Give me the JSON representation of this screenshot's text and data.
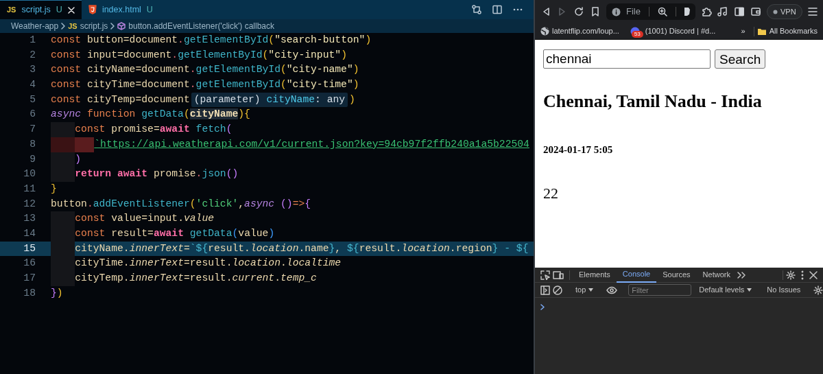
{
  "editor": {
    "tabs": [
      {
        "kind": "js",
        "badge": "JS",
        "label": "script.js",
        "status": "U",
        "selected": true,
        "closable": true
      },
      {
        "kind": "html",
        "label": "index.html",
        "status": "U",
        "selected": false,
        "closable": false
      }
    ],
    "breadcrumb": [
      {
        "kind": "folder",
        "text": "Weather-app"
      },
      {
        "kind": "js",
        "badge": "JS",
        "text": "script.js"
      },
      {
        "kind": "symbol",
        "text": "button.addEventListener('click') callback"
      }
    ],
    "lines": [
      {
        "number": "1",
        "selected": false,
        "tokens": [
          {
            "kind": "kw",
            "text": "const "
          },
          {
            "kind": "var",
            "text": "button=document"
          },
          {
            "kind": "dot",
            "text": "."
          },
          {
            "kind": "fn",
            "text": "getElementById"
          },
          {
            "kind": "br1",
            "text": "("
          },
          {
            "kind": "str",
            "text": "\"search-button\""
          },
          {
            "kind": "br1",
            "text": ")"
          }
        ]
      },
      {
        "number": "2",
        "selected": false,
        "tokens": [
          {
            "kind": "kw",
            "text": "const "
          },
          {
            "kind": "var",
            "text": "input=document"
          },
          {
            "kind": "dot",
            "text": "."
          },
          {
            "kind": "fn",
            "text": "getElementById"
          },
          {
            "kind": "br1",
            "text": "("
          },
          {
            "kind": "str",
            "text": "\"city-input\""
          },
          {
            "kind": "br1",
            "text": ")"
          }
        ]
      },
      {
        "number": "3",
        "selected": false,
        "tokens": [
          {
            "kind": "kw",
            "text": "const "
          },
          {
            "kind": "var",
            "text": "cityName=document"
          },
          {
            "kind": "dot",
            "text": "."
          },
          {
            "kind": "fn",
            "text": "getElementById"
          },
          {
            "kind": "br1",
            "text": "("
          },
          {
            "kind": "str",
            "text": "\"city-name\""
          },
          {
            "kind": "br1",
            "text": ")"
          }
        ]
      },
      {
        "number": "4",
        "selected": false,
        "tokens": [
          {
            "kind": "kw",
            "text": "const "
          },
          {
            "kind": "var",
            "text": "cityTime=document"
          },
          {
            "kind": "dot",
            "text": "."
          },
          {
            "kind": "fn",
            "text": "getElementById"
          },
          {
            "kind": "br1",
            "text": "("
          },
          {
            "kind": "str",
            "text": "\"city-time\""
          },
          {
            "kind": "br1",
            "text": ")"
          }
        ]
      },
      {
        "number": "5",
        "selected": false,
        "tokens": [
          {
            "kind": "kw",
            "text": "const "
          },
          {
            "kind": "var",
            "text": "cityTemp=document"
          },
          {
            "kind": "tooltip",
            "parts": [
              {
                "kind": "tip",
                "text": "(parameter) "
              },
              {
                "kind": "tipname",
                "text": "cityName"
              },
              {
                "kind": "tip",
                "text": ": any"
              }
            ]
          },
          {
            "kind": "br1",
            "text": ")"
          }
        ]
      },
      {
        "number": "6",
        "selected": false,
        "tokens": [
          {
            "kind": "async",
            "text": "async "
          },
          {
            "kind": "kw",
            "text": "function "
          },
          {
            "kind": "fn",
            "text": "getData"
          },
          {
            "kind": "br1",
            "text": "("
          },
          {
            "kind": "param",
            "text": "cityName"
          },
          {
            "kind": "br1",
            "text": "){"
          }
        ]
      },
      {
        "number": "7",
        "selected": false,
        "indent": [
          {
            "kind": "plain"
          }
        ],
        "tokens": [
          {
            "kind": "kw",
            "text": "const "
          },
          {
            "kind": "var",
            "text": "promise="
          },
          {
            "kind": "await",
            "text": "await "
          },
          {
            "kind": "fn",
            "text": "fetch"
          },
          {
            "kind": "br2",
            "text": "("
          }
        ]
      },
      {
        "number": "8",
        "selected": false,
        "indent": [
          {
            "kind": "error"
          },
          {
            "kind": "error"
          }
        ],
        "tokens": [
          {
            "kind": "url",
            "text": "`https://api.weatherapi.com/v1/current.json?key=94cb97f2ffb240a1a5b22504"
          }
        ]
      },
      {
        "number": "9",
        "selected": false,
        "indent": [
          {
            "kind": "plain"
          }
        ],
        "tokens": [
          {
            "kind": "br2",
            "text": ")"
          }
        ]
      },
      {
        "number": "10",
        "selected": false,
        "indent": [
          {
            "kind": "plain"
          }
        ],
        "tokens": [
          {
            "kind": "await",
            "text": "return await "
          },
          {
            "kind": "var",
            "text": "promise"
          },
          {
            "kind": "dot",
            "text": "."
          },
          {
            "kind": "fn",
            "text": "json"
          },
          {
            "kind": "br2",
            "text": "()"
          }
        ]
      },
      {
        "number": "11",
        "selected": false,
        "tokens": [
          {
            "kind": "br1",
            "text": "}"
          }
        ]
      },
      {
        "number": "12",
        "selected": false,
        "tokens": [
          {
            "kind": "var",
            "text": "button"
          },
          {
            "kind": "dot",
            "text": "."
          },
          {
            "kind": "fn",
            "text": "addEventListener"
          },
          {
            "kind": "br1",
            "text": "("
          },
          {
            "kind": "str2",
            "text": "'click'"
          },
          {
            "kind": "var",
            "text": ","
          },
          {
            "kind": "async",
            "text": "async "
          },
          {
            "kind": "br2",
            "text": "()"
          },
          {
            "kind": "kw",
            "text": "=>"
          },
          {
            "kind": "br2",
            "text": "{"
          }
        ]
      },
      {
        "number": "13",
        "selected": false,
        "indent": [
          {
            "kind": "plain"
          }
        ],
        "tokens": [
          {
            "kind": "kw",
            "text": "const "
          },
          {
            "kind": "var",
            "text": "value=input."
          },
          {
            "kind": "it",
            "text": "value"
          }
        ]
      },
      {
        "number": "14",
        "selected": false,
        "indent": [
          {
            "kind": "plain"
          }
        ],
        "tokens": [
          {
            "kind": "kw",
            "text": "const "
          },
          {
            "kind": "var",
            "text": "result="
          },
          {
            "kind": "await",
            "text": "await "
          },
          {
            "kind": "fn",
            "text": "getData"
          },
          {
            "kind": "br3",
            "text": "("
          },
          {
            "kind": "var",
            "text": "value"
          },
          {
            "kind": "br3",
            "text": ")"
          }
        ]
      },
      {
        "number": "15",
        "selected": true,
        "indent": [
          {
            "kind": "plain"
          }
        ],
        "tokens": [
          {
            "kind": "var",
            "text": "cityName."
          },
          {
            "kind": "it",
            "text": "innerText"
          },
          {
            "kind": "var",
            "text": "="
          },
          {
            "kind": "tpl",
            "text": "`${"
          },
          {
            "kind": "var",
            "text": "result."
          },
          {
            "kind": "it",
            "text": "location"
          },
          {
            "kind": "var",
            "text": ".name"
          },
          {
            "kind": "tpl",
            "text": "}"
          },
          {
            "kind": "var",
            "text": ", "
          },
          {
            "kind": "tpl",
            "text": "${"
          },
          {
            "kind": "var",
            "text": "result."
          },
          {
            "kind": "it",
            "text": "location"
          },
          {
            "kind": "var",
            "text": ".region"
          },
          {
            "kind": "tpl",
            "text": "} - ${"
          }
        ]
      },
      {
        "number": "16",
        "selected": false,
        "indent": [
          {
            "kind": "plain"
          }
        ],
        "tokens": [
          {
            "kind": "var",
            "text": "cityTime."
          },
          {
            "kind": "it",
            "text": "innerText"
          },
          {
            "kind": "var",
            "text": "=result."
          },
          {
            "kind": "it",
            "text": "location"
          },
          {
            "kind": "var",
            "text": "."
          },
          {
            "kind": "it",
            "text": "localtime"
          }
        ]
      },
      {
        "number": "17",
        "selected": false,
        "indent": [
          {
            "kind": "plain"
          }
        ],
        "tokens": [
          {
            "kind": "var",
            "text": "cityTemp."
          },
          {
            "kind": "it",
            "text": "innerText"
          },
          {
            "kind": "var",
            "text": "=result."
          },
          {
            "kind": "it",
            "text": "current"
          },
          {
            "kind": "var",
            "text": "."
          },
          {
            "kind": "it",
            "text": "temp_c"
          }
        ]
      },
      {
        "number": "18",
        "selected": false,
        "tokens": [
          {
            "kind": "br2",
            "text": "}"
          },
          {
            "kind": "br1",
            "text": ")"
          }
        ]
      }
    ]
  },
  "browser": {
    "nav": [
      {
        "kind": "back",
        "disabled": false
      },
      {
        "kind": "forward",
        "disabled": true
      },
      {
        "kind": "reload",
        "disabled": false
      },
      {
        "kind": "bookmark",
        "disabled": false
      }
    ],
    "address": {
      "text": "File"
    },
    "extensions": [
      {
        "kind": "puzzle"
      },
      {
        "kind": "music"
      },
      {
        "kind": "sidebar"
      },
      {
        "kind": "wallet"
      }
    ],
    "vpn": "VPN",
    "bookmarks": [
      {
        "kind": "globe",
        "label": "latentflip.com/loup..."
      },
      {
        "kind": "discord",
        "badge": "53",
        "label": "(1001) Discord | #d..."
      }
    ],
    "bookmarks_overflow": "»",
    "bookmarks_folder": "All Bookmarks",
    "page": {
      "search_value": "chennai",
      "button": "Search",
      "city": "Chennai, Tamil Nadu - India",
      "time": "2024-01-17 5:05",
      "temp": "22"
    },
    "devtools": {
      "tabs": [
        {
          "label": "Elements",
          "selected": false
        },
        {
          "label": "Console",
          "selected": true
        },
        {
          "label": "Sources",
          "selected": false
        },
        {
          "label": "Network",
          "selected": false
        }
      ],
      "context": "top",
      "filter_placeholder": "Filter",
      "levels": "Default levels",
      "issues": "No Issues"
    }
  }
}
